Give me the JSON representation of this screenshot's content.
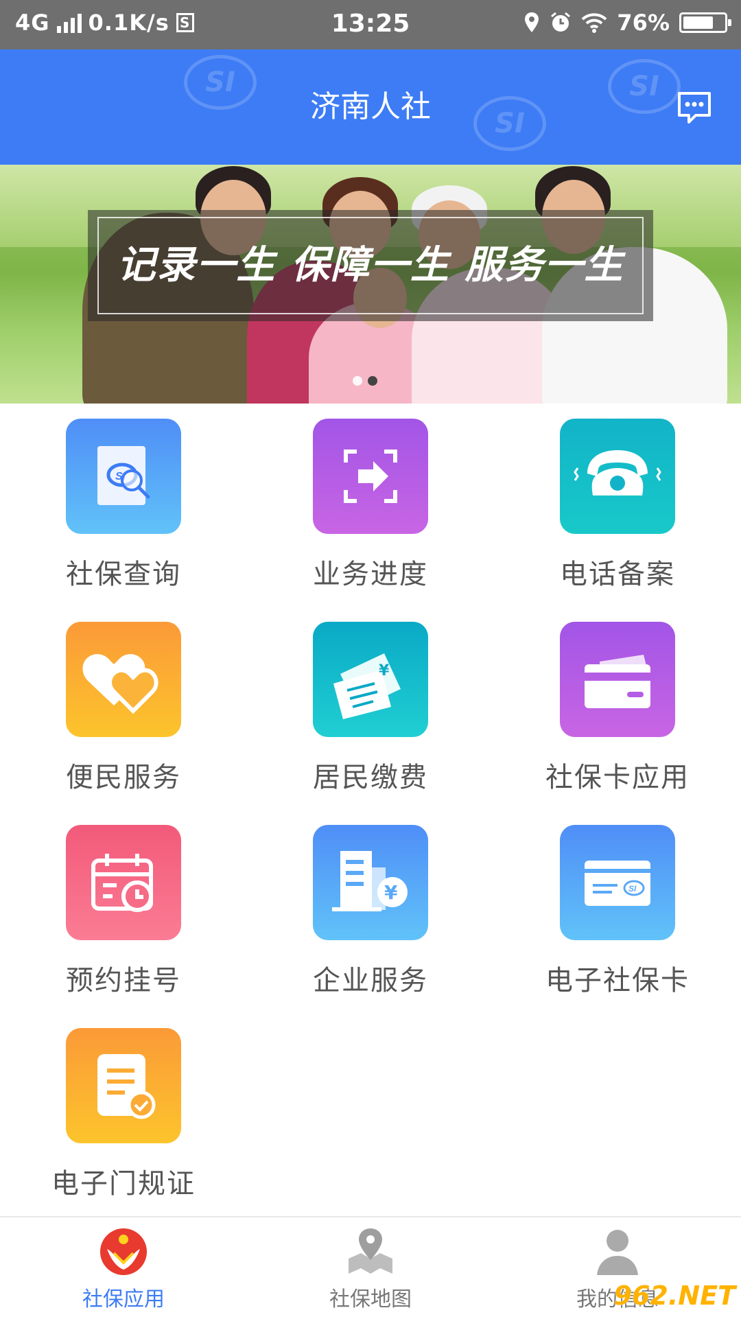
{
  "status_bar": {
    "network": "4G",
    "speed": "0.1K/s",
    "s_badge": "S",
    "time": "13:25",
    "battery_percent": "76%",
    "battery_level": 0.76
  },
  "header": {
    "title": "济南人社",
    "watermark_text": "SI",
    "message_icon": "chat-bubble-icon"
  },
  "banner": {
    "slogan": "记录一生 保障一生 服务一生",
    "slide_count": 2,
    "active_slide": 2
  },
  "services": [
    {
      "label": "社保查询",
      "icon": "document-search-icon",
      "color_from": "#4f8ef7",
      "color_to": "#61c2f8"
    },
    {
      "label": "业务进度",
      "icon": "scan-arrow-icon",
      "color_from": "#a255e6",
      "color_to": "#c865e4"
    },
    {
      "label": "电话备案",
      "icon": "telephone-icon",
      "color_from": "#12b3c8",
      "color_to": "#18c9c9"
    },
    {
      "label": "便民服务",
      "icon": "hearts-icon",
      "color_from": "#fb9a38",
      "color_to": "#fcc42c"
    },
    {
      "label": "居民缴费",
      "icon": "bill-yuan-icon",
      "color_from": "#0aa9c6",
      "color_to": "#20cfd2"
    },
    {
      "label": "社保卡应用",
      "icon": "wallet-card-icon",
      "color_from": "#a255e6",
      "color_to": "#c865e4"
    },
    {
      "label": "预约挂号",
      "icon": "calendar-clock-icon",
      "color_from": "#f25a7a",
      "color_to": "#fb7c94"
    },
    {
      "label": "企业服务",
      "icon": "building-yuan-icon",
      "color_from": "#4f8ef7",
      "color_to": "#61c2f8"
    },
    {
      "label": "电子社保卡",
      "icon": "si-card-icon",
      "color_from": "#4f8ef7",
      "color_to": "#61c2f8"
    },
    {
      "label": "电子门规证",
      "icon": "certificate-check-icon",
      "color_from": "#fb9a38",
      "color_to": "#fcc42c"
    }
  ],
  "bottom_nav": {
    "items": [
      {
        "label": "社保应用",
        "icon": "si-logo-icon",
        "active": true
      },
      {
        "label": "社保地图",
        "icon": "map-pin-icon",
        "active": false
      },
      {
        "label": "我的信息",
        "icon": "user-icon",
        "active": false
      }
    ],
    "active_color": "#3d7cf5"
  },
  "watermark": "962.NET"
}
